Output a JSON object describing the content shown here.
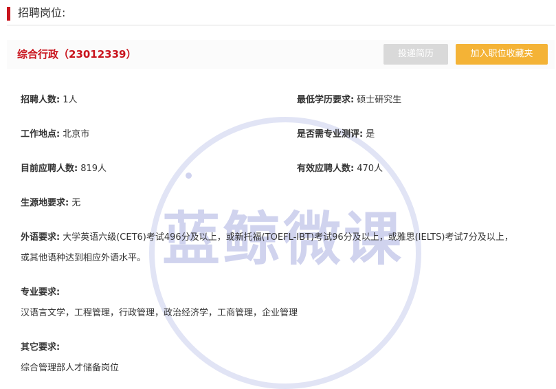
{
  "section": {
    "title": "招聘岗位:"
  },
  "job": {
    "title": "综合行政（23012339）"
  },
  "buttons": {
    "apply": "投递简历",
    "favorite": "加入职位收藏夹"
  },
  "fields": {
    "recruit_count_label": "招聘人数:",
    "recruit_count_value": "1人",
    "education_label": "最低学历要求:",
    "education_value": "硕士研究生",
    "location_label": "工作地点:",
    "location_value": "北京市",
    "test_label": "是否需专业测评:",
    "test_value": "是",
    "current_applicants_label": "目前应聘人数:",
    "current_applicants_value": "819人",
    "valid_applicants_label": "有效应聘人数:",
    "valid_applicants_value": "470人",
    "origin_label": "生源地要求:",
    "origin_value": "无"
  },
  "language": {
    "label": "外语要求:",
    "line1": "大学英语六级(CET6)考试496分及以上，或新托福(TOEFL-IBT)考试96分及以上，或雅思(IELTS)考试7分及以上，",
    "line2": "或其他语种达到相应外语水平。"
  },
  "major": {
    "label": "专业要求:",
    "value": "汉语言文学，工程管理，行政管理，政治经济学，工商管理，企业管理"
  },
  "other": {
    "label": "其它要求:",
    "value": "综合管理部人才储备岗位"
  },
  "watermark": {
    "text": "蓝鲸微课"
  }
}
